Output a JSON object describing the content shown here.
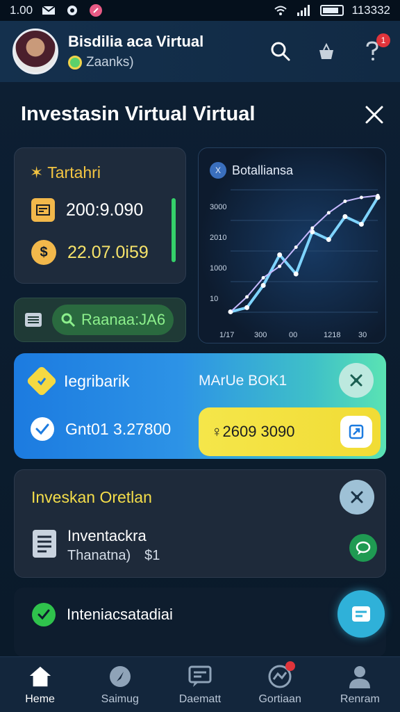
{
  "status_bar": {
    "time_left": "1.00",
    "time_right": "113332"
  },
  "header": {
    "title": "Bisdilia aca  Virtual",
    "subtitle": "Zaanks)",
    "notification_count": "1"
  },
  "page": {
    "title": "Investasin Virtual Virtual"
  },
  "summary_card": {
    "title": "Tartahri",
    "value1": "200:9.090",
    "value2": "22.07.0i59"
  },
  "filter_pill": {
    "label": "Raanaa:JA6"
  },
  "chart_card": {
    "title": "Botalliansa",
    "icon_label": "X"
  },
  "chart_data": {
    "type": "line",
    "title": "Botalliansa",
    "x": [
      "1/17",
      "300",
      "00",
      "1218",
      "30"
    ],
    "y_ticks": [
      "3000",
      "2010",
      "1000",
      "10"
    ],
    "series": [
      {
        "values": [
          10,
          120,
          700,
          1500,
          1000,
          2100,
          1900,
          2500,
          2300,
          3000
        ]
      },
      {
        "values": [
          10,
          400,
          900,
          1200,
          1700,
          2200,
          2600,
          2900,
          3000,
          3050
        ]
      }
    ],
    "ylim": [
      0,
      3200
    ],
    "grid": true
  },
  "balance_card": {
    "label1": "Iegribarik",
    "label2": "MArUe BOK1",
    "value1": "Gnt01 3.27800",
    "value2": "♀2609 3090"
  },
  "invest_card": {
    "title": "Inveskan Oretlan",
    "item_title": "Inventackra",
    "item_sub": "Thanatna)",
    "item_value": "$1"
  },
  "row_d": {
    "label": "Inteniacsatadiai"
  },
  "tabs": [
    {
      "label": "Heme"
    },
    {
      "label": "Saimug"
    },
    {
      "label": "Daematt"
    },
    {
      "label": "Gortiaan"
    },
    {
      "label": "Renram"
    }
  ]
}
